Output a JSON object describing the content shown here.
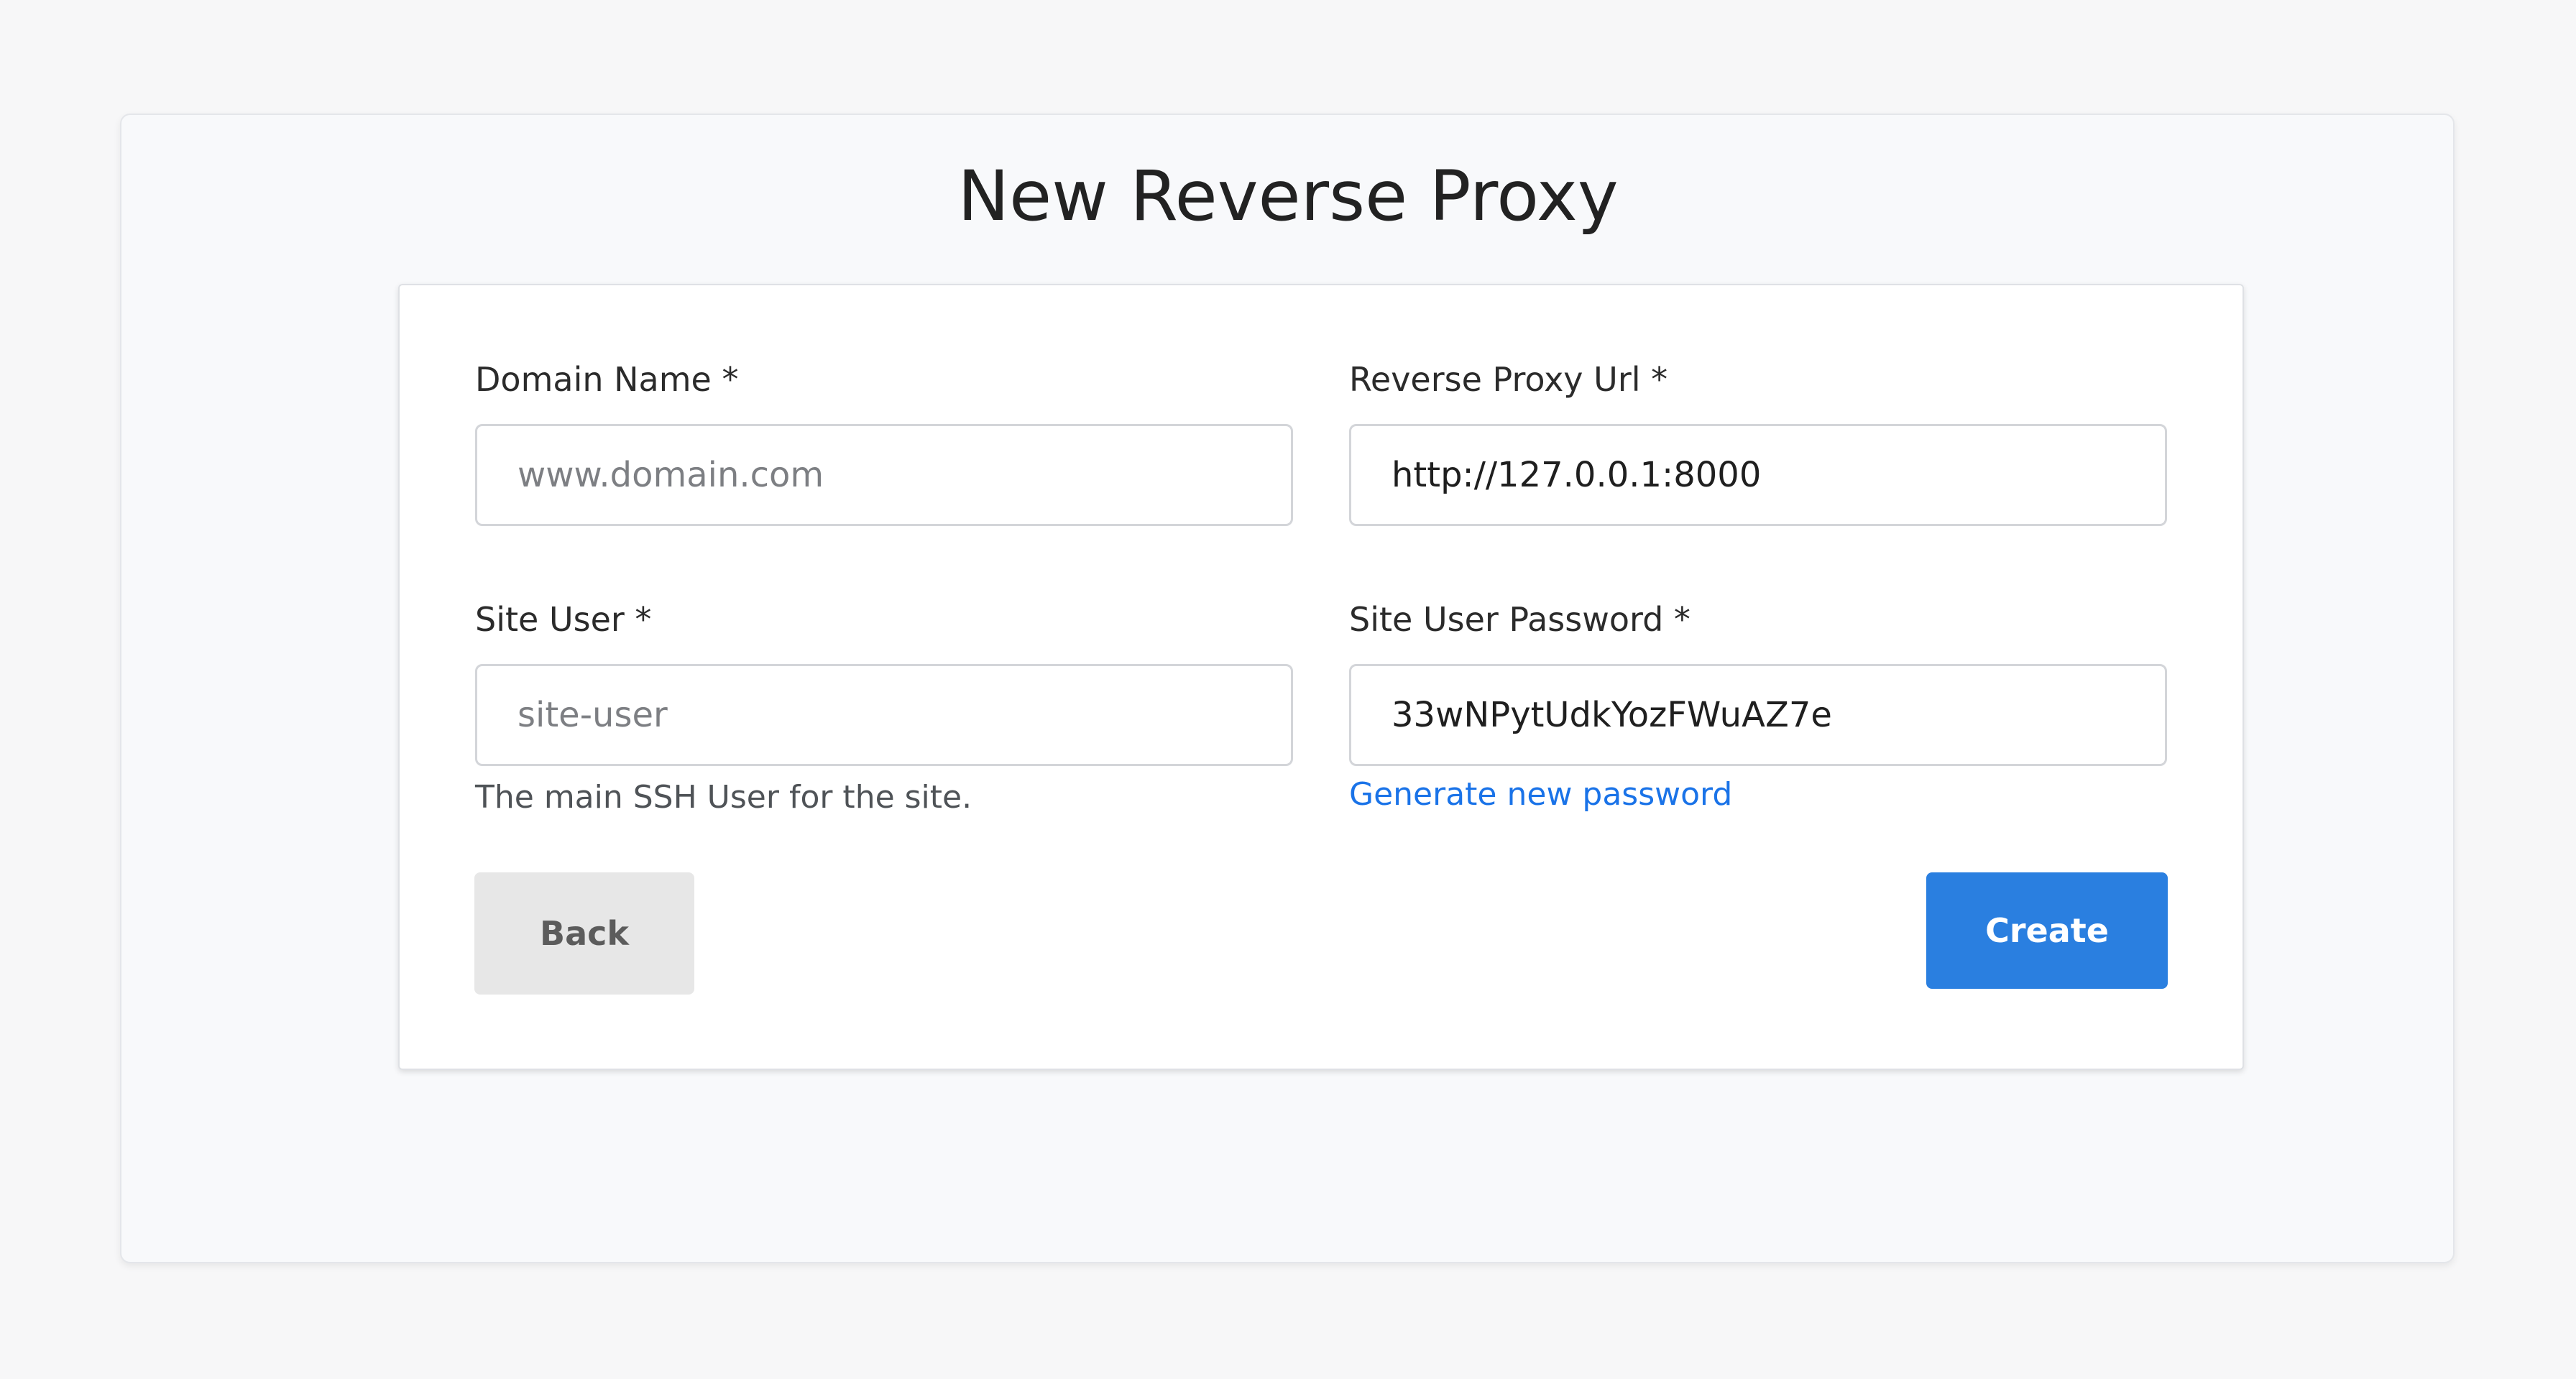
{
  "page": {
    "title": "New Reverse Proxy"
  },
  "form": {
    "domain_name": {
      "label": "Domain Name *",
      "value": "",
      "placeholder": "www.domain.com"
    },
    "reverse_proxy_url": {
      "label": "Reverse Proxy Url *",
      "value": "http://127.0.0.1:8000",
      "placeholder": ""
    },
    "site_user": {
      "label": "Site User *",
      "value": "",
      "placeholder": "site-user",
      "help": "The main SSH User for the site."
    },
    "site_user_password": {
      "label": "Site User Password *",
      "value": "33wNPytUdkYozFWuAZ7e",
      "generate_link": "Generate new password"
    }
  },
  "actions": {
    "back_label": "Back",
    "create_label": "Create"
  },
  "colors": {
    "primary": "#2a7fe0",
    "link": "#1a73e8",
    "secondary_button": "#e7e7e7",
    "page_background": "#f7f7f8"
  }
}
